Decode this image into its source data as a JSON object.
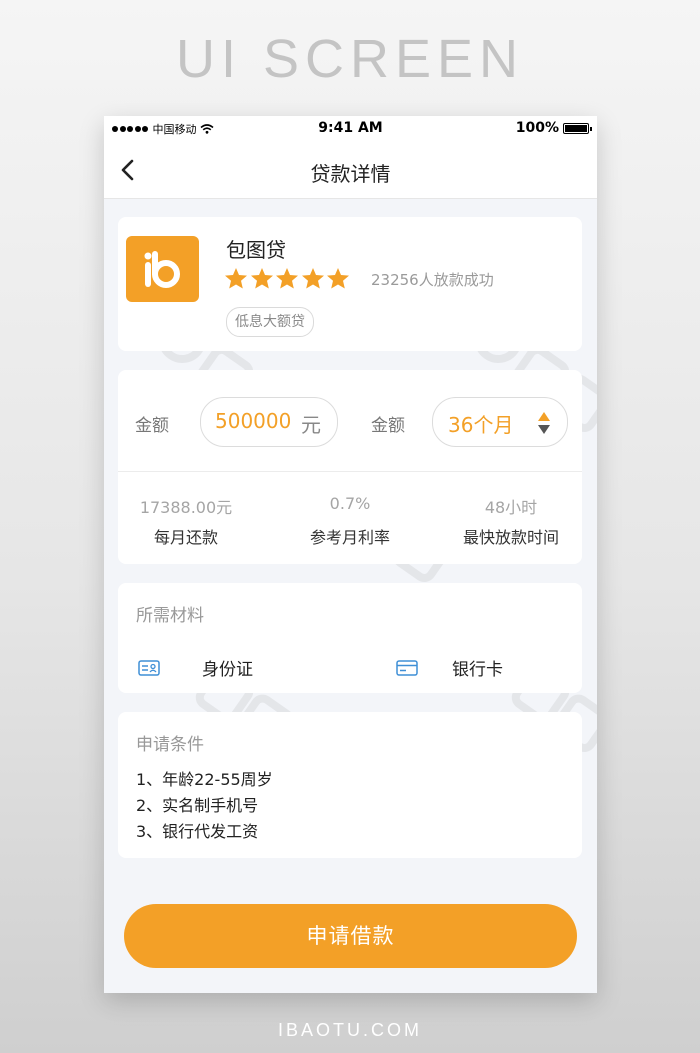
{
  "page_heading": "UI SCREEN",
  "footer": "IBAOTU.COM",
  "status_bar": {
    "carrier": "中国移动",
    "time": "9:41 AM",
    "battery": "100%"
  },
  "nav": {
    "title": "贷款详情"
  },
  "product": {
    "logo_glyph": "b",
    "name": "包图贷",
    "rating": 5,
    "review_count": "23256人放款成功",
    "tag": "低息大额贷"
  },
  "loan": {
    "amount_label": "金额",
    "amount_value": "500000",
    "amount_unit": "元",
    "term_label": "金额",
    "term_value": "36个月",
    "stats": [
      {
        "value": "17388.00元",
        "label": "每月还款"
      },
      {
        "value": "0.7%",
        "label": "参考月利率"
      },
      {
        "value": "48小时",
        "label": "最快放款时间"
      }
    ]
  },
  "materials": {
    "title": "所需材料",
    "items": [
      {
        "icon": "id-card-icon",
        "label": "身份证"
      },
      {
        "icon": "bank-card-icon",
        "label": "银行卡"
      }
    ]
  },
  "conditions": {
    "title": "申请条件",
    "items": [
      "1、年龄22-55周岁",
      "2、实名制手机号",
      "3、银行代发工资"
    ]
  },
  "apply_button": "申请借款",
  "colors": {
    "accent": "#f3a027",
    "background": "#f3f5f9",
    "card": "#ffffff"
  }
}
